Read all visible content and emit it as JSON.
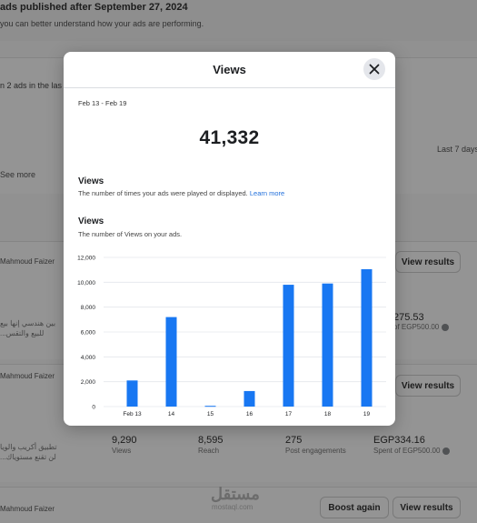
{
  "background": {
    "header_line1": "ads published after September 27, 2024",
    "header_line2": "you can better understand how your ads are performing.",
    "ads_count_text": "n 2 ads in the las",
    "last_days": "Last 7 days",
    "see_more": "See more",
    "rows": [
      {
        "author": "Mahmoud Faizer",
        "snippet_line1": "بين هندسي إنها بيع",
        "snippet_line2": "...للبيع والتقس",
        "spent_value": "275.53",
        "spent_label": "of EGP500.00",
        "view_results": "View results"
      },
      {
        "author": "Mahmoud Faizer",
        "snippet_line1": "تطبيق أكريب والويا",
        "snippet_line2": "...لن تقنع مستوياك",
        "stats": [
          {
            "value": "9,290",
            "label": "Views"
          },
          {
            "value": "8,595",
            "label": "Reach"
          },
          {
            "value": "275",
            "label": "Post engagements"
          },
          {
            "value": "EGP334.16",
            "label": "Spent of EGP500.00"
          }
        ],
        "view_results": "View results"
      },
      {
        "author": "Mahmoud Faizer",
        "boost_again": "Boost again",
        "view_results": "View results"
      }
    ],
    "watermark_arabic": "مستقل",
    "watermark_url": "mostaql.com"
  },
  "modal": {
    "title": "Views",
    "date_range": "Feb 13 - Feb 19",
    "total": "41,332",
    "section1": {
      "title": "Views",
      "description": "The number of times your ads were played or displayed.",
      "learn_more": "Learn more"
    },
    "section2": {
      "title": "Views",
      "description": "The number of Views on your ads."
    }
  },
  "colors": {
    "bar": "#1877f2",
    "link": "#216fdb"
  },
  "chart_data": {
    "type": "bar",
    "categories": [
      "Feb 13",
      "14",
      "15",
      "16",
      "17",
      "18",
      "19"
    ],
    "values": [
      2100,
      7200,
      60,
      1250,
      9800,
      9900,
      11050
    ],
    "ylim": [
      0,
      12000
    ],
    "yticks": [
      "0",
      "2,000",
      "4,000",
      "6,000",
      "8,000",
      "10,000",
      "12,000"
    ],
    "ytick_values": [
      0,
      2000,
      4000,
      6000,
      8000,
      10000,
      12000
    ]
  }
}
